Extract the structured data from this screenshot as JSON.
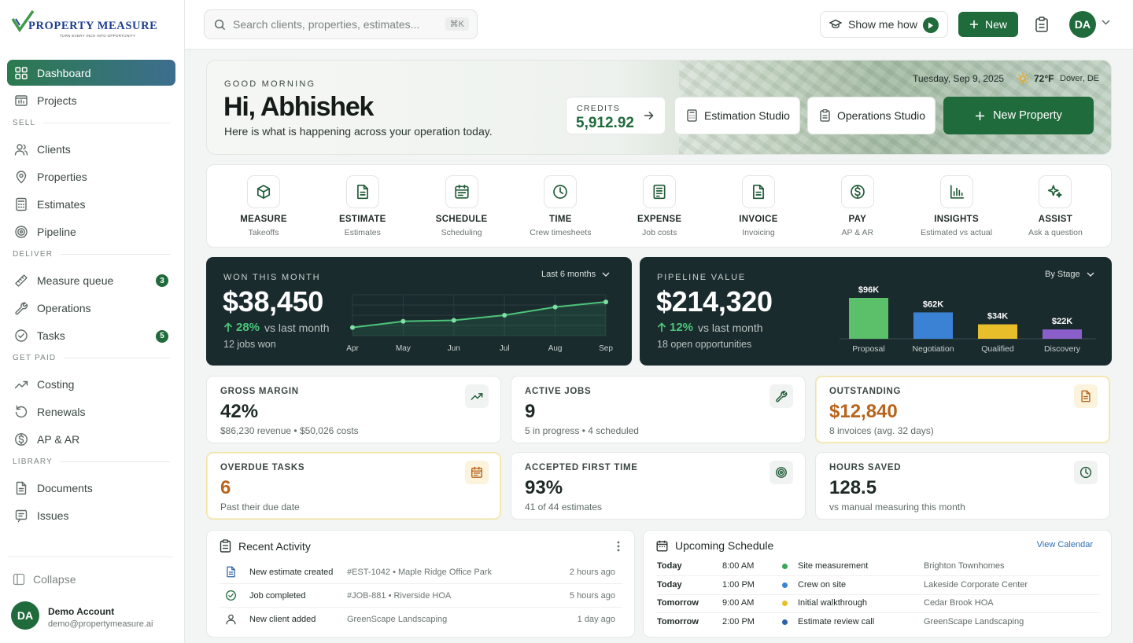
{
  "brand": {
    "name": "PROPERTY MEASURE",
    "tagline": "TURN EVERY INCH INTO OPPORTUNITY"
  },
  "sidebar": {
    "top": [
      {
        "label": "Dashboard",
        "icon": "grid-icon"
      },
      {
        "label": "Projects",
        "icon": "folder-icon"
      }
    ],
    "sections": [
      {
        "title": "SELL",
        "items": [
          {
            "label": "Clients",
            "icon": "users-icon"
          },
          {
            "label": "Properties",
            "icon": "pin-icon"
          },
          {
            "label": "Estimates",
            "icon": "calculator-icon"
          },
          {
            "label": "Pipeline",
            "icon": "target-icon"
          }
        ]
      },
      {
        "title": "DELIVER",
        "items": [
          {
            "label": "Measure queue",
            "icon": "ruler-icon",
            "badge": "3"
          },
          {
            "label": "Operations",
            "icon": "wrench-icon"
          },
          {
            "label": "Tasks",
            "icon": "check-circle-icon",
            "badge": "5"
          }
        ]
      },
      {
        "title": "GET PAID",
        "items": [
          {
            "label": "Costing",
            "icon": "trend-icon"
          },
          {
            "label": "Renewals",
            "icon": "refresh-icon"
          },
          {
            "label": "AP & AR",
            "icon": "dollar-icon"
          }
        ]
      },
      {
        "title": "LIBRARY",
        "items": [
          {
            "label": "Documents",
            "icon": "document-icon"
          },
          {
            "label": "Issues",
            "icon": "flag-icon"
          }
        ]
      }
    ],
    "collapse": "Collapse",
    "account": {
      "initials": "DA",
      "name": "Demo Account",
      "email": "demo@propertymeasure.ai"
    }
  },
  "header": {
    "search_placeholder": "Search clients, properties, estimates...",
    "search_kbd": "⌘K",
    "show_me": "Show me how",
    "new": "New",
    "avatar": "DA"
  },
  "hero": {
    "greeting": "GOOD MORNING",
    "title": "Hi, Abhishek",
    "subtitle": "Here is what is happening across your operation today.",
    "date": "Tuesday, Sep 9, 2025",
    "temp": "72°F",
    "location": "Dover, DE",
    "credits_label": "CREDITS",
    "credits_value": "5,912.92",
    "estimation": "Estimation Studio",
    "operations": "Operations Studio",
    "new_property": "New Property"
  },
  "quick_actions": [
    {
      "label": "MEASURE",
      "sub": "Takeoffs",
      "icon": "cube-icon"
    },
    {
      "label": "ESTIMATE",
      "sub": "Estimates",
      "icon": "document-icon"
    },
    {
      "label": "SCHEDULE",
      "sub": "Scheduling",
      "icon": "calendar-icon"
    },
    {
      "label": "TIME",
      "sub": "Crew timesheets",
      "icon": "clock-icon"
    },
    {
      "label": "EXPENSE",
      "sub": "Job costs",
      "icon": "receipt-icon"
    },
    {
      "label": "INVOICE",
      "sub": "Invoicing",
      "icon": "invoice-icon"
    },
    {
      "label": "PAY",
      "sub": "AP & AR",
      "icon": "dollar-icon"
    },
    {
      "label": "INSIGHTS",
      "sub": "Estimated vs actual",
      "icon": "bar-chart-icon"
    },
    {
      "label": "ASSIST",
      "sub": "Ask a question",
      "icon": "sparkle-icon"
    }
  ],
  "won": {
    "label": "WON THIS MONTH",
    "value": "$38,450",
    "pct": "28%",
    "vs": "vs last month",
    "sub": "12 jobs won",
    "range": "Last 6 months"
  },
  "pipeline": {
    "label": "PIPELINE VALUE",
    "value": "$214,320",
    "pct": "12%",
    "vs": "vs last month",
    "sub": "18 open opportunities",
    "range": "By Stage"
  },
  "chart_data": [
    {
      "type": "line",
      "title": "",
      "categories": [
        "Apr",
        "May",
        "Jun",
        "Jul",
        "Aug",
        "Sep"
      ],
      "series": [
        {
          "values": [
            8,
            14,
            15,
            20,
            28,
            33
          ]
        }
      ],
      "ylim": [
        0,
        40
      ],
      "grid": true
    },
    {
      "type": "bar",
      "title": "",
      "categories": [
        "Proposal",
        "Negotiation",
        "Qualified",
        "Discovery"
      ],
      "values": [
        96,
        62,
        34,
        22
      ],
      "labels": [
        "$96K",
        "$62K",
        "$34K",
        "$22K"
      ],
      "colors": [
        "#5cbf6a",
        "#3b82d4",
        "#e8bf2a",
        "#8b5fc9"
      ]
    }
  ],
  "stats": [
    {
      "label": "GROSS MARGIN",
      "value": "42%",
      "sub": "$86,230 revenue • $50,026 costs",
      "icon": "trend-icon",
      "warn": false
    },
    {
      "label": "ACTIVE JOBS",
      "value": "9",
      "sub": "5 in progress • 4 scheduled",
      "icon": "wrench-icon",
      "warn": false
    },
    {
      "label": "OUTSTANDING",
      "value": "$12,840",
      "sub": "8 invoices (avg. 32 days)",
      "icon": "invoice-icon",
      "warn": true
    },
    {
      "label": "OVERDUE TASKS",
      "value": "6",
      "sub": "Past their due date",
      "icon": "calendar-icon",
      "warn": true
    },
    {
      "label": "ACCEPTED FIRST TIME",
      "value": "93%",
      "sub": "41 of 44 estimates",
      "icon": "target-icon",
      "warn": false
    },
    {
      "label": "HOURS SAVED",
      "value": "128.5",
      "sub": "vs manual measuring this month",
      "icon": "clock-icon",
      "warn": false
    }
  ],
  "activity": {
    "title": "Recent Activity",
    "rows": [
      {
        "text": "New estimate created",
        "ref": "#EST-1042  •  Maple Ridge Office Park",
        "when": "2 hours ago",
        "icon": "document-icon"
      },
      {
        "text": "Job completed",
        "ref": "#JOB-881  •  Riverside HOA",
        "when": "5 hours ago",
        "icon": "check-circle-icon"
      },
      {
        "text": "New client added",
        "ref": "GreenScape Landscaping",
        "when": "1 day ago",
        "icon": "user-icon"
      }
    ]
  },
  "schedule": {
    "title": "Upcoming Schedule",
    "view": "View Calendar",
    "rows": [
      {
        "day": "Today",
        "time": "8:00 AM",
        "name": "Site measurement",
        "place": "Brighton Townhomes",
        "color": "#3aa55a"
      },
      {
        "day": "Today",
        "time": "1:00 PM",
        "name": "Crew on site",
        "place": "Lakeside Corporate Center",
        "color": "#3b82d4"
      },
      {
        "day": "Tomorrow",
        "time": "9:00 AM",
        "name": "Initial walkthrough",
        "place": "Cedar Brook HOA",
        "color": "#e8bf2a"
      },
      {
        "day": "Tomorrow",
        "time": "2:00 PM",
        "name": "Estimate review call",
        "place": "GreenScape Landscaping",
        "color": "#2e5fa8"
      }
    ]
  }
}
